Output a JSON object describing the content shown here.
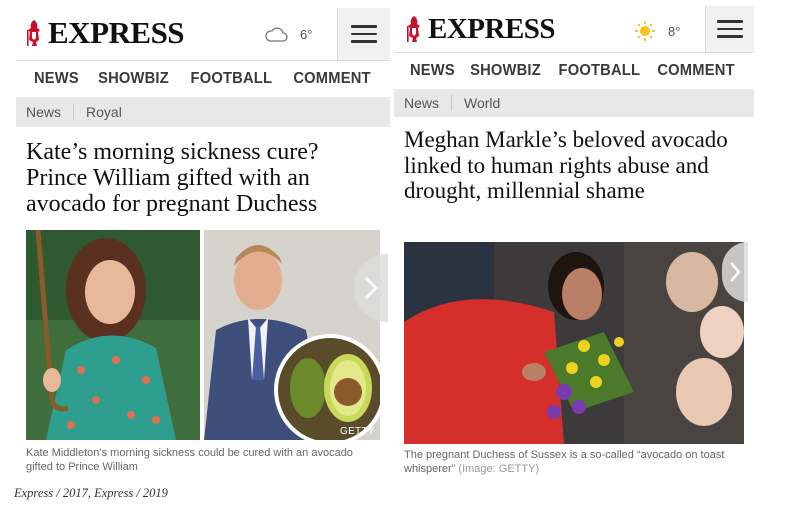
{
  "left": {
    "logo": "EXPRESS",
    "weather": {
      "icon": "cloud-icon",
      "temp": "6°"
    },
    "nav": [
      "NEWS",
      "SHOWBIZ",
      "FOOTBALL",
      "COMMENT"
    ],
    "breadcrumb": [
      "News",
      "Royal"
    ],
    "headline": "Kate’s morning sickness cure? Prince William gifted with an avocado for pregnant Duchess",
    "image_credit": "GETTY",
    "caption": "Kate Middleton’s morning sickness could be cured with an avocado gifted to Prince William"
  },
  "right": {
    "logo": "EXPRESS",
    "weather": {
      "icon": "sun-icon",
      "temp": "8°"
    },
    "nav": [
      "NEWS",
      "SHOWBIZ",
      "FOOTBALL",
      "COMMENT"
    ],
    "breadcrumb": [
      "News",
      "World"
    ],
    "headline": "Meghan Markle’s beloved avocado linked to human rights abuse and drought, millennial shame",
    "caption": "The pregnant Duchess of Sussex is a so-called “avocado on toast whisperer”",
    "caption_credit": "(Image: GETTY)"
  },
  "footer": "Express / 2017, Express / 2019",
  "colors": {
    "brand_red": "#c8102e",
    "nav_text": "#3a3a3a",
    "breadcrumb_bg": "#e8e8e8"
  }
}
